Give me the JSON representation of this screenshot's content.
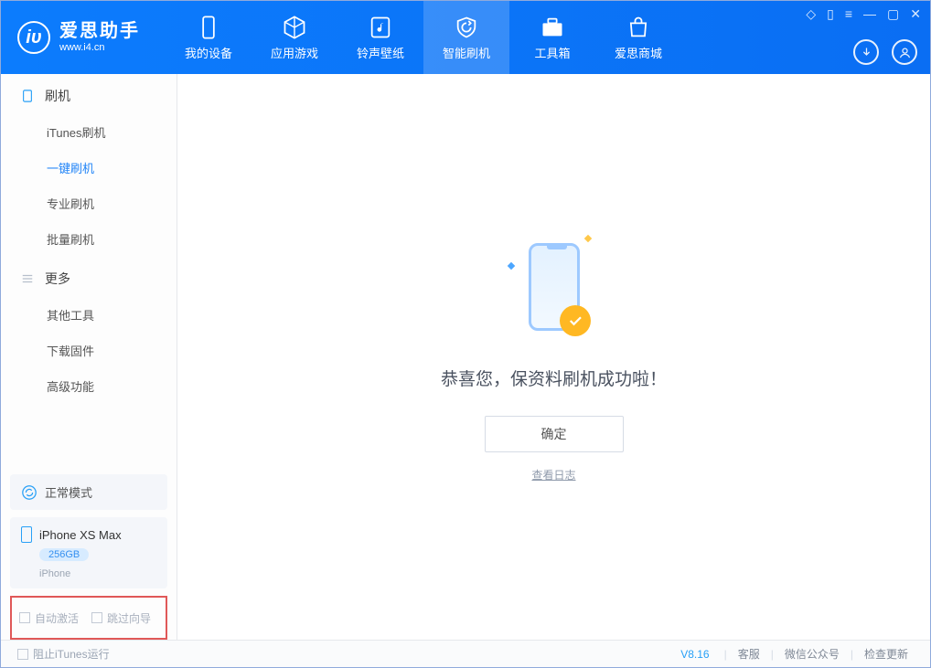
{
  "app": {
    "title": "爱思助手",
    "subtitle": "www.i4.cn"
  },
  "main_tabs": [
    {
      "label": "我的设备"
    },
    {
      "label": "应用游戏"
    },
    {
      "label": "铃声壁纸"
    },
    {
      "label": "智能刷机"
    },
    {
      "label": "工具箱"
    },
    {
      "label": "爱思商城"
    }
  ],
  "sidebar": {
    "section1_title": "刷机",
    "items1": [
      {
        "label": "iTunes刷机"
      },
      {
        "label": "一键刷机"
      },
      {
        "label": "专业刷机"
      },
      {
        "label": "批量刷机"
      }
    ],
    "section2_title": "更多",
    "items2": [
      {
        "label": "其他工具"
      },
      {
        "label": "下载固件"
      },
      {
        "label": "高级功能"
      }
    ],
    "normal_mode": "正常模式",
    "device_name": "iPhone XS Max",
    "device_capacity": "256GB",
    "device_type": "iPhone",
    "auto_activate": "自动激活",
    "skip_guide": "跳过向导"
  },
  "content": {
    "success_message": "恭喜您，保资料刷机成功啦！",
    "ok_button": "确定",
    "view_log": "查看日志"
  },
  "footer": {
    "block_itunes": "阻止iTunes运行",
    "version": "V8.16",
    "customer_service": "客服",
    "wechat": "微信公众号",
    "check_update": "检查更新"
  }
}
